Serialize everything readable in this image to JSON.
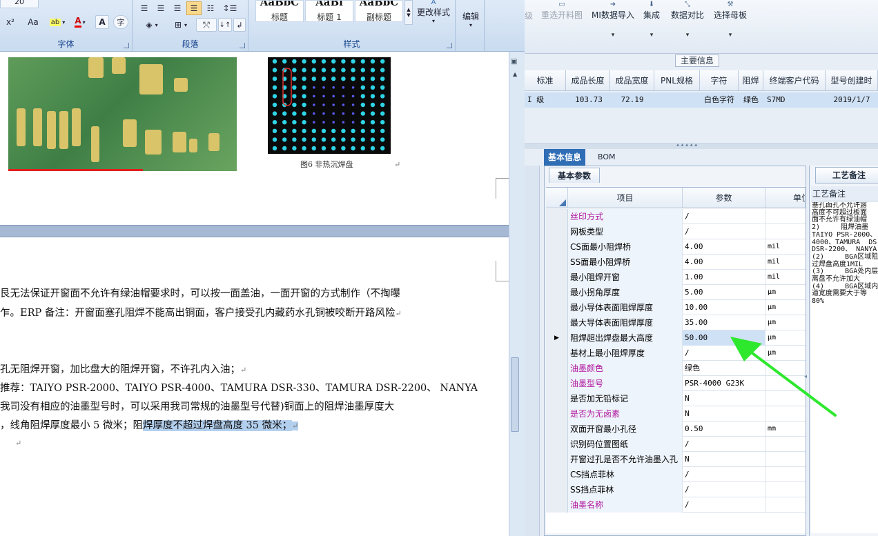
{
  "word": {
    "ribbon": {
      "font_group_label": "字体",
      "paragraph_group_label": "段落",
      "styles_group_label": "样式",
      "font_buttons": [
        "x²",
        "Aa"
      ],
      "styles": [
        {
          "sample": "AaBbC",
          "name": "标题"
        },
        {
          "sample": "AaBl",
          "name": "标题 1"
        },
        {
          "sample": "AaBbC",
          "name": "副标题"
        }
      ],
      "change_styles_label": "更改样式",
      "edit_label": "编辑"
    },
    "figure_caption": "图6  非热沉焊盘",
    "paragraphs": [
      "艮无法保证开窗面不允许有绿油帽要求时，可以按一面盖油，一面开窗的方式制作（不掏曝",
      "乍。ERP 备注：开窗面塞孔阻焊不能高出铜面，客户接受孔内藏药水孔铜被咬断开路风险",
      "孔无阻焊开窗，加比盘大的阻焊开窗，不许孔内入油；",
      "推荐：TAIYO PSR-2000、TAIYO PSR-4000、TAMURA  DSR-330、TAMURA DSR-2200、 NANYA",
      "我司没有相应的油墨型号时，可以采用我司常规的油墨型号代替)铜面上的阻焊油墨厚度大",
      "，线角阻焊厚度最小 5 微米；阻",
      "焊厚度不超过焊盘高度 35 微米；"
    ]
  },
  "erp": {
    "toolbar": [
      {
        "label": "级",
        "disabled": true
      },
      {
        "label": "重选开料图",
        "disabled": true
      },
      {
        "label": "MI数据导入",
        "disabled": false
      },
      {
        "label": "集成",
        "disabled": false
      },
      {
        "label": "数据对比",
        "disabled": false
      },
      {
        "label": "选择母板",
        "disabled": false
      }
    ],
    "section_title": "主要信息",
    "top_grid": {
      "headers": [
        "标准",
        "成品长度",
        "成品宽度",
        "PNL规格",
        "字符",
        "阻焊",
        "终端客户代码",
        "型号创建时"
      ],
      "row": [
        "I 级",
        "103.73",
        "72.19",
        "",
        "白色字符",
        "绿色",
        "S7MD",
        "2019/1/7"
      ]
    },
    "tabs": [
      "基本信息",
      "BOM"
    ],
    "subtab": "基本参数",
    "grid_headers": [
      "项目",
      "参数",
      "单位"
    ],
    "rows": [
      {
        "name": "丝印方式",
        "value": "/",
        "unit": "",
        "purple": true
      },
      {
        "name": "网板类型",
        "value": "/",
        "unit": "",
        "purple": false
      },
      {
        "name": "CS面最小阻焊桥",
        "value": "4.00",
        "unit": "mil",
        "purple": false
      },
      {
        "name": "SS面最小阻焊桥",
        "value": "4.00",
        "unit": "mil",
        "purple": false
      },
      {
        "name": "最小阻焊开窗",
        "value": "1.00",
        "unit": "mil",
        "purple": false
      },
      {
        "name": "最小拐角厚度",
        "value": "5.00",
        "unit": "µm",
        "purple": false
      },
      {
        "name": "最小导体表面阻焊厚度",
        "value": "10.00",
        "unit": "µm",
        "purple": false
      },
      {
        "name": "最大导体表面阻焊厚度",
        "value": "35.00",
        "unit": "µm",
        "purple": false
      },
      {
        "name": "阻焊超出焊盘最大高度",
        "value": "50.00",
        "unit": "µm",
        "purple": false,
        "selected": true
      },
      {
        "name": "基材上最小阻焊厚度",
        "value": "/",
        "unit": "µm",
        "purple": false
      },
      {
        "name": "油墨颜色",
        "value": "绿色",
        "unit": "",
        "purple": true
      },
      {
        "name": "油墨型号",
        "value": "PSR-4000 G23K",
        "unit": "",
        "purple": true
      },
      {
        "name": "是否加无铅标记",
        "value": "N",
        "unit": "",
        "purple": false
      },
      {
        "name": "是否为无卤素",
        "value": "N",
        "unit": "",
        "purple": true
      },
      {
        "name": "双面开窗最小孔径",
        "value": "0.50",
        "unit": "mm",
        "purple": false
      },
      {
        "name": "识别码位置图纸",
        "value": "/",
        "unit": "",
        "purple": false
      },
      {
        "name": "开窗过孔是否不允许油墨入孔",
        "value": "N",
        "unit": "",
        "purple": false
      },
      {
        "name": "CS挡点菲林",
        "value": "/",
        "unit": "",
        "purple": false
      },
      {
        "name": "SS挡点菲林",
        "value": "/",
        "unit": "",
        "purple": false
      },
      {
        "name": "油墨名称",
        "value": "/",
        "unit": "",
        "purple": true
      }
    ],
    "notes_tab": "工艺备注",
    "notes_label": "工艺备注",
    "notes_text": "塞孔面孔不允许露\n高度不可超过板面\n面不允许有绿油帽\n2)     阻焊油墨\nTAIYO PSR-2000、\n4000、TAMURA  DS\nDSR-2200、 NANYA\n(2)     BGA区域阻\n过焊盘高度1MIL\n(3)     BGA处内层\n离盘不允许加大\n(4)     BGA区域内\n道宽度需要大于等\n80%",
    "colors": {
      "accent": "#2f6db5",
      "purple_text": "#b0169e",
      "arrow": "#2ee82e"
    }
  }
}
